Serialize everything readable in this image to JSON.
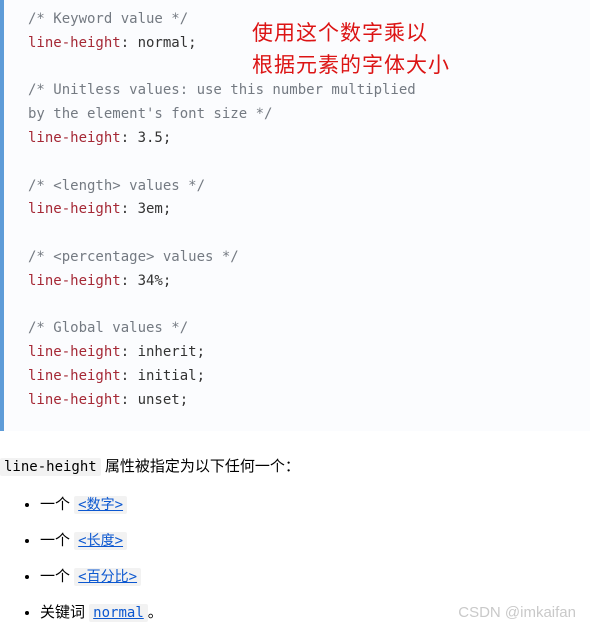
{
  "overlay": {
    "line1": "使用这个数字乘以",
    "line2": "根据元素的字体大小"
  },
  "code": {
    "c1": "/* Keyword value */",
    "p": "line-height",
    "v1": "normal",
    "c2": "/* Unitless values: use this number multiplied",
    "c2b": "by the element's font size */",
    "v2": "3.5",
    "c3": "/* <length> values */",
    "v3": "3em",
    "c4": "/* <percentage> values */",
    "v4": "34%",
    "c5": "/* Global values */",
    "v5": "inherit",
    "v6": "initial",
    "v7": "unset",
    "colon": ": ",
    "semi": ";"
  },
  "prose": {
    "code": "line-height",
    "rest": " 属性被指定为以下任何一个：",
    "li_prefix": "一个 ",
    "links": {
      "num": "<数字>",
      "len": "<长度>",
      "pct": "<百分比>",
      "normal": "normal"
    },
    "li4_prefix": "关键词 ",
    "li4_suffix": "。"
  },
  "watermark": "CSDN @imkaifan"
}
